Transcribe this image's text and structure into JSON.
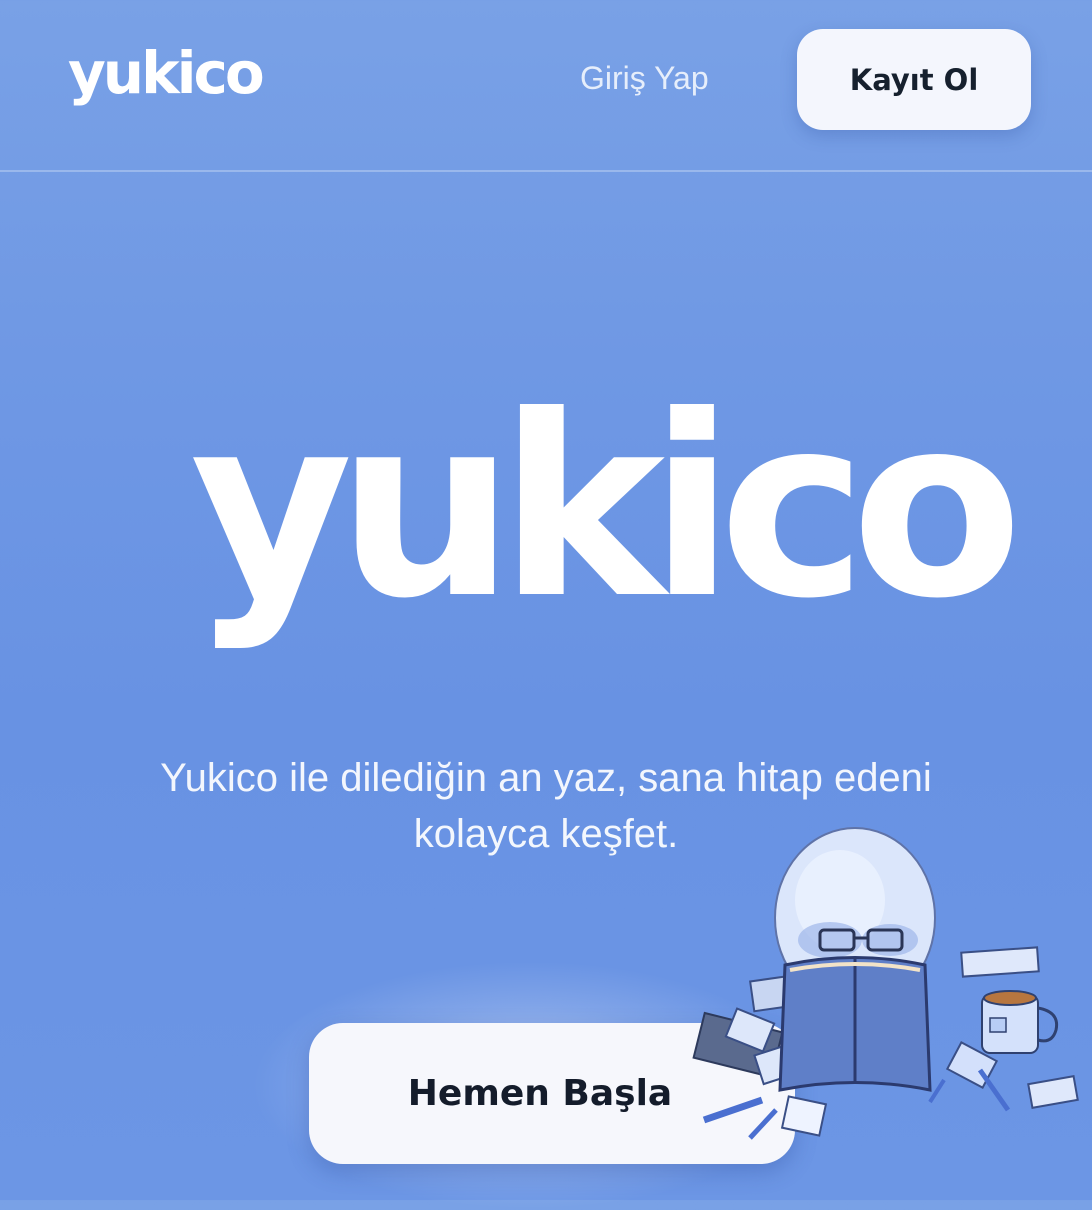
{
  "header": {
    "brand": "yukico",
    "login_label": "Giriş Yap",
    "signup_label": "Kayıt Ol"
  },
  "hero": {
    "logo_text": "yukico",
    "tagline_line1": "Yukico ile dilediğin an yaz, sana hitap edeni",
    "tagline_line2": "kolayca keşfet.",
    "cta_label": "Hemen Başla"
  },
  "colors": {
    "background": "#6c96e5",
    "button_bg": "#f4f6fd",
    "button_text": "#16202e",
    "brand_text": "#ffffff"
  },
  "icons": {
    "mascot": "reading-snowball-mascot-illustration"
  }
}
